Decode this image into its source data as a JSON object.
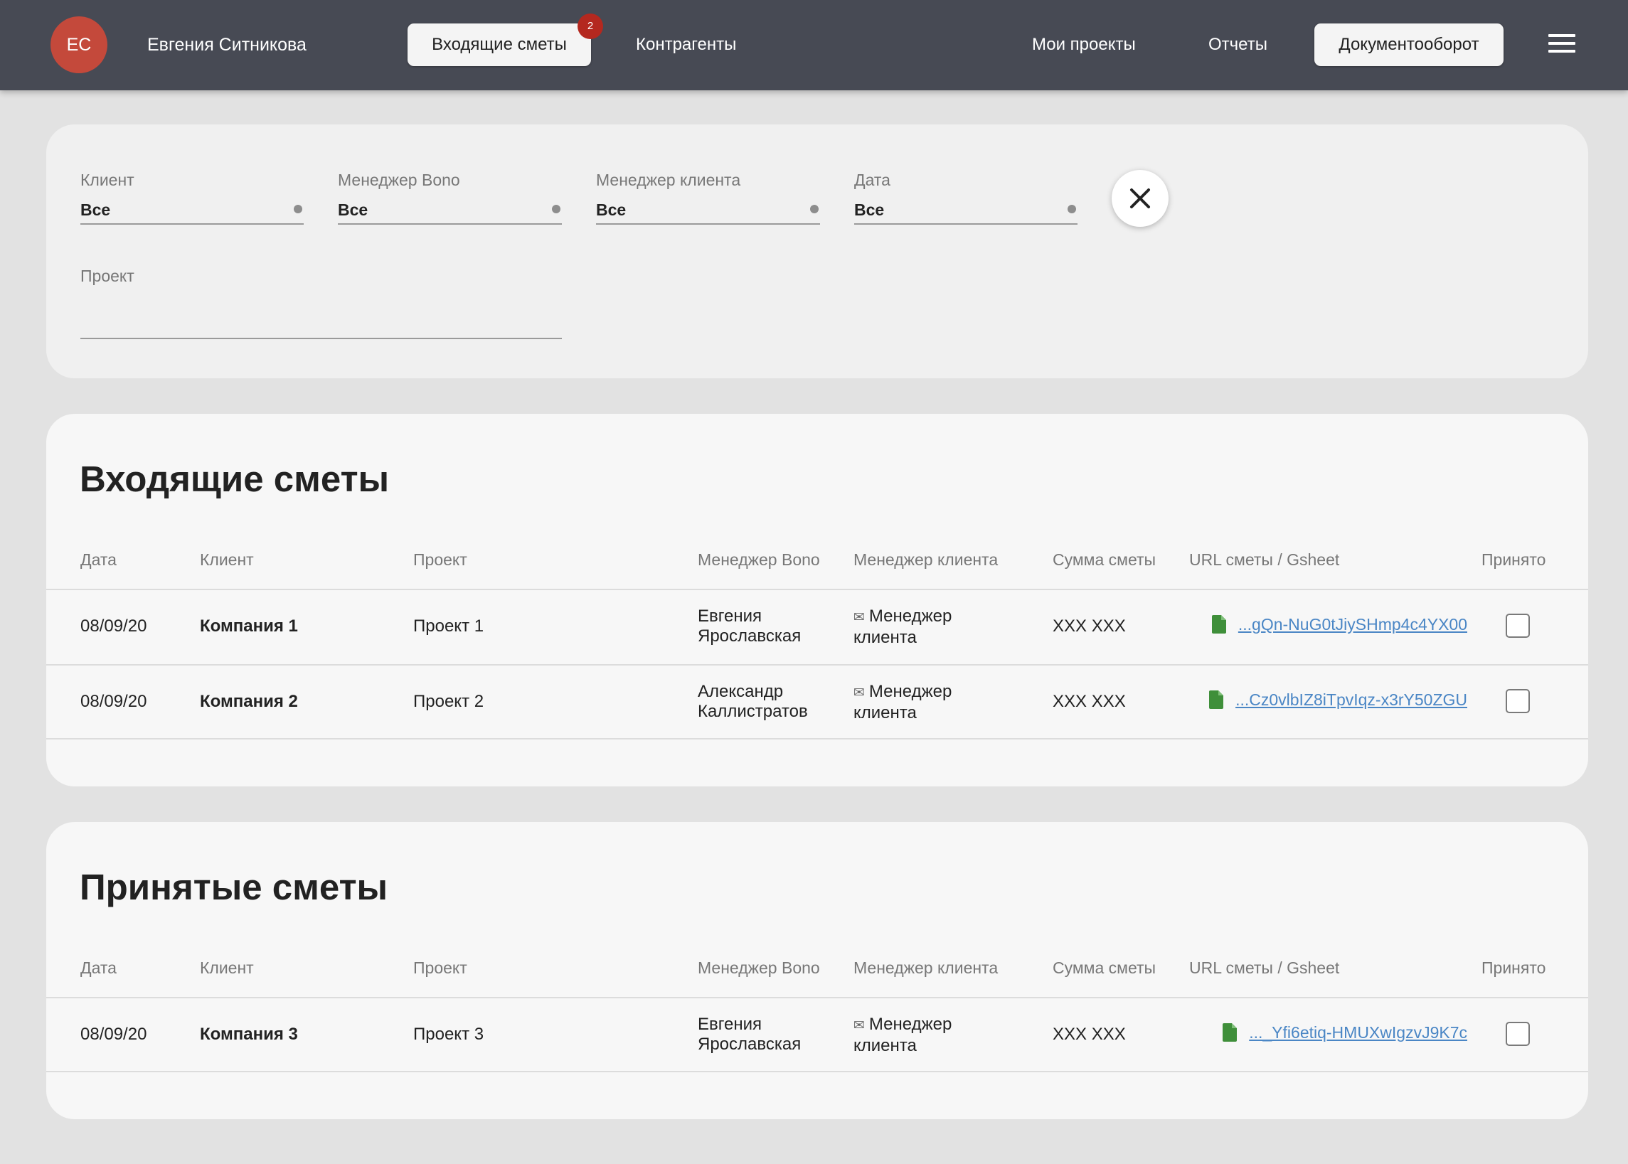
{
  "header": {
    "avatar_initials": "ЕС",
    "user_name": "Евгения Ситникова",
    "nav": {
      "incoming": "Входящие сметы",
      "incoming_badge": "2",
      "contractors": "Контрагенты",
      "my_projects": "Мои проекты",
      "reports": "Отчеты",
      "documents": "Документооборот"
    },
    "menu_icon": "hamburger-icon"
  },
  "filters": {
    "client": {
      "label": "Клиент",
      "value": "Все"
    },
    "manager_bono": {
      "label": "Менеджер Bono",
      "value": "Все"
    },
    "manager_client": {
      "label": "Менеджер клиента",
      "value": "Все"
    },
    "date": {
      "label": "Дата",
      "value": "Все"
    },
    "project": {
      "label": "Проект",
      "value": ""
    },
    "close_icon": "close-icon"
  },
  "columns": {
    "date": "Дата",
    "client": "Клиент",
    "project": "Проект",
    "manager_bono": "Менеджер Bono",
    "manager_client": "Менеджер клиента",
    "sum": "Сумма сметы",
    "url": "URL сметы / Gsheet",
    "accepted": "Принято"
  },
  "incoming": {
    "title": "Входящие сметы",
    "rows": [
      {
        "date": "08/09/20",
        "client": "Компания 1",
        "project": "Проект 1",
        "manager_bono_1": "Евгения",
        "manager_bono_2": "Ярославская",
        "manager_client_1": "Менеджер",
        "manager_client_2": "клиента",
        "sum": "XXX XXX",
        "url": "...gQn-NuG0tJiySHmp4c4YX00",
        "accepted": false
      },
      {
        "date": "08/09/20",
        "client": "Компания 2",
        "project": "Проект 2",
        "manager_bono_1": "Александр",
        "manager_bono_2": "Каллистратов",
        "manager_client_1": "Менеджер",
        "manager_client_2": "клиента",
        "sum": "XXX XXX",
        "url": "...Cz0vlbIZ8iTpvIqz-x3rY50ZGU",
        "accepted": false
      }
    ]
  },
  "accepted": {
    "title": "Принятые сметы",
    "rows": [
      {
        "date": "08/09/20",
        "client": "Компания 3",
        "project": "Проект 3",
        "manager_bono_1": "Евгения",
        "manager_bono_2": "Ярославская",
        "manager_client_1": "Менеджер",
        "manager_client_2": "клиента",
        "sum": "XXX XXX",
        "url": "..._Yfi6etiq-HMUXwIgzvJ9K7c",
        "accepted": false
      }
    ]
  },
  "colors": {
    "header_bg": "#474a54",
    "avatar_bg": "#c4493b",
    "badge_bg": "#b4281f",
    "link": "#4a86c5",
    "file_icon": "#3f8f3a"
  }
}
